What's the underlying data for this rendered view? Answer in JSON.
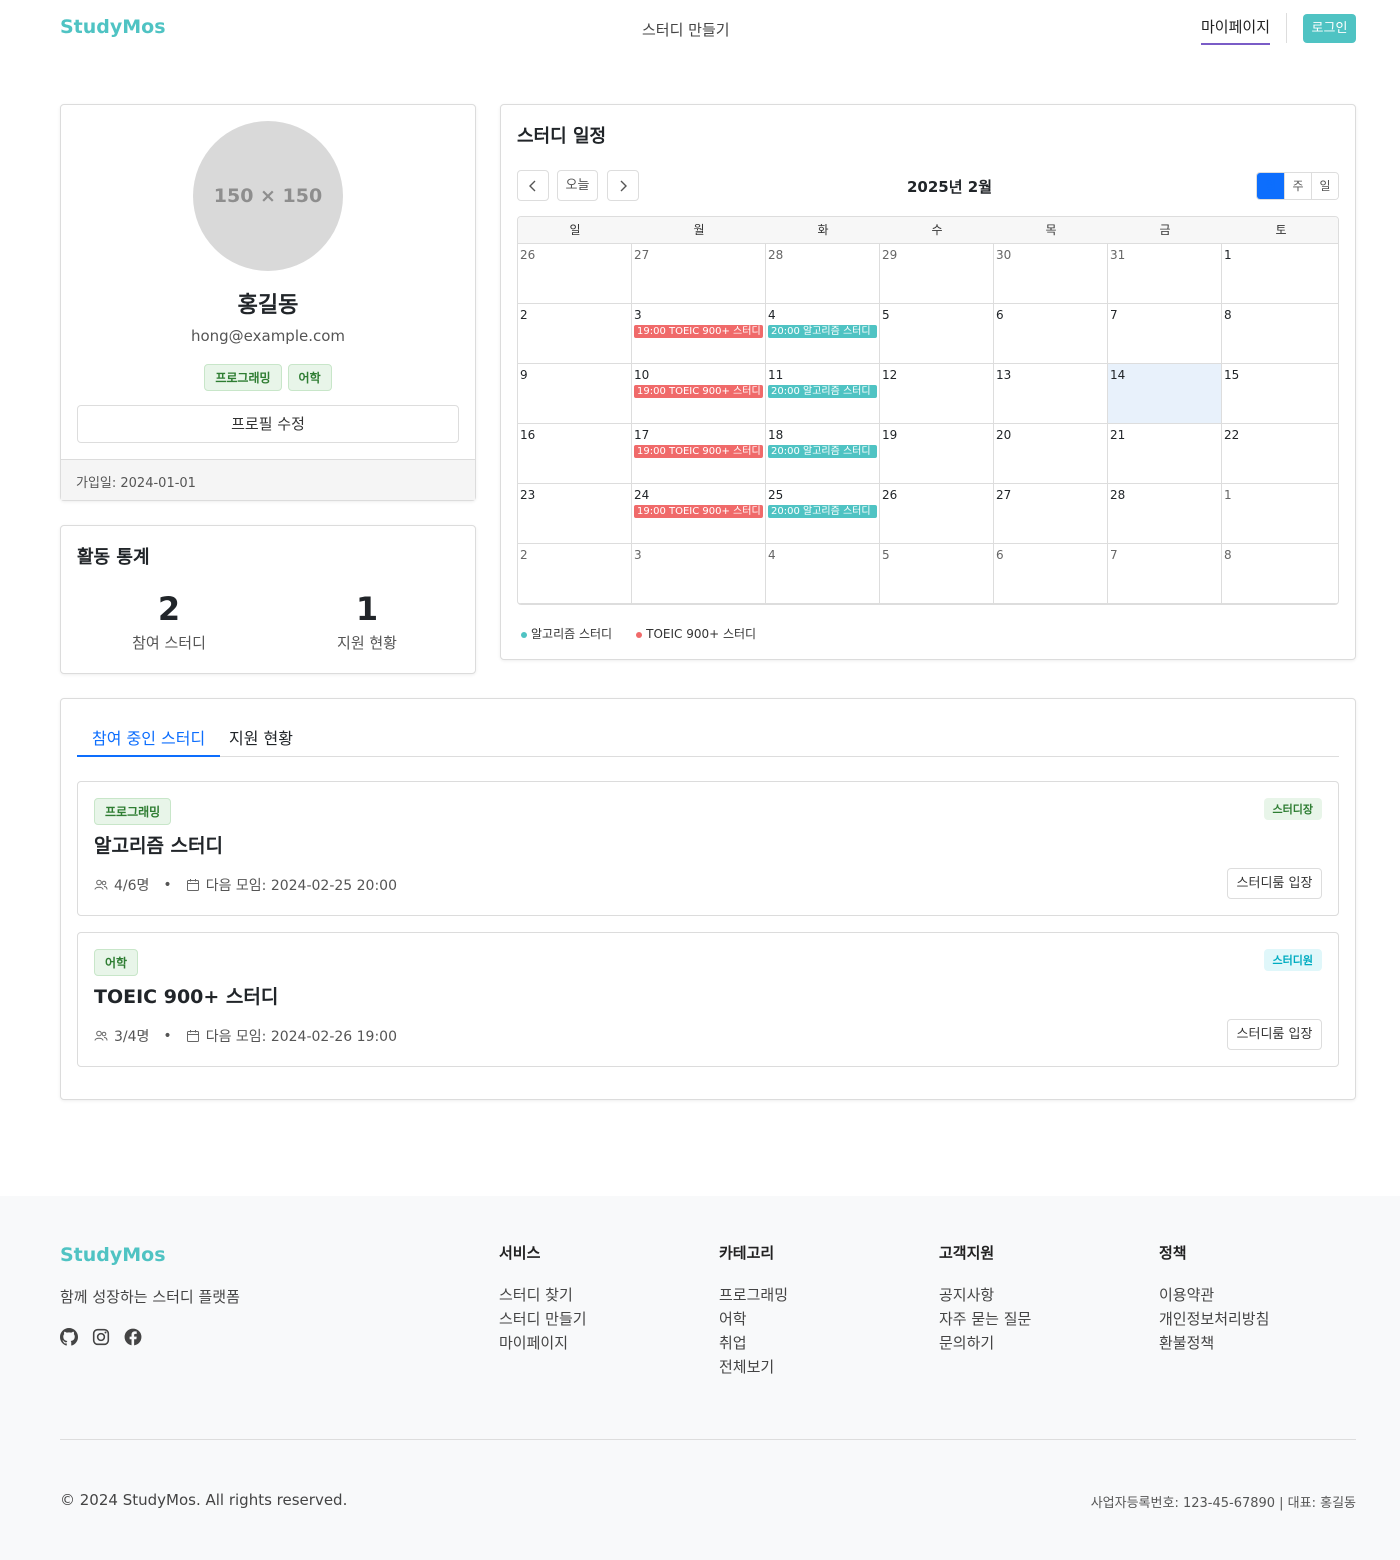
{
  "header": {
    "brand": "StudyMos",
    "nav_create": "스터디 만들기",
    "nav_mypage": "마이페이지",
    "login": "로그인"
  },
  "profile": {
    "avatar_placeholder": "150 × 150",
    "name": "홍길동",
    "email": "hong@example.com",
    "tags": [
      "프로그래밍",
      "어학"
    ],
    "edit_button": "프로필 수정",
    "joined": "가입일: 2024-01-01"
  },
  "stats": {
    "title": "활동 통계",
    "items": [
      {
        "value": "2",
        "label": "참여 스터디"
      },
      {
        "value": "1",
        "label": "지원 현황"
      }
    ]
  },
  "calendar": {
    "title": "스터디 일정",
    "today_button": "오늘",
    "month_label": "2025년 2월",
    "views": [
      "월",
      "주",
      "일"
    ],
    "active_view": "월",
    "weekdays": [
      "일",
      "월",
      "화",
      "수",
      "목",
      "금",
      "토"
    ],
    "today": 14,
    "colors": {
      "algorithm": "#4fc3c3",
      "toeic": "#f06a6a"
    },
    "weeks": [
      [
        {
          "d": "26",
          "o": true
        },
        {
          "d": "27",
          "o": true
        },
        {
          "d": "28",
          "o": true
        },
        {
          "d": "29",
          "o": true
        },
        {
          "d": "30",
          "o": true
        },
        {
          "d": "31",
          "o": true
        },
        {
          "d": "1"
        }
      ],
      [
        {
          "d": "2"
        },
        {
          "d": "3",
          "ev": "19:00 TOEIC 900+ 스터디",
          "c": "toeic"
        },
        {
          "d": "4",
          "ev": "20:00 알고리즘 스터디",
          "c": "algorithm"
        },
        {
          "d": "5"
        },
        {
          "d": "6"
        },
        {
          "d": "7"
        },
        {
          "d": "8"
        }
      ],
      [
        {
          "d": "9"
        },
        {
          "d": "10",
          "ev": "19:00 TOEIC 900+ 스터디",
          "c": "toeic"
        },
        {
          "d": "11",
          "ev": "20:00 알고리즘 스터디",
          "c": "algorithm"
        },
        {
          "d": "12"
        },
        {
          "d": "13"
        },
        {
          "d": "14"
        },
        {
          "d": "15"
        }
      ],
      [
        {
          "d": "16"
        },
        {
          "d": "17",
          "ev": "19:00 TOEIC 900+ 스터디",
          "c": "toeic"
        },
        {
          "d": "18",
          "ev": "20:00 알고리즘 스터디",
          "c": "algorithm"
        },
        {
          "d": "19"
        },
        {
          "d": "20"
        },
        {
          "d": "21"
        },
        {
          "d": "22"
        }
      ],
      [
        {
          "d": "23"
        },
        {
          "d": "24",
          "ev": "19:00 TOEIC 900+ 스터디",
          "c": "toeic"
        },
        {
          "d": "25",
          "ev": "20:00 알고리즘 스터디",
          "c": "algorithm"
        },
        {
          "d": "26"
        },
        {
          "d": "27"
        },
        {
          "d": "28"
        },
        {
          "d": "1",
          "o": true
        }
      ],
      [
        {
          "d": "2",
          "o": true
        },
        {
          "d": "3",
          "o": true
        },
        {
          "d": "4",
          "o": true
        },
        {
          "d": "5",
          "o": true
        },
        {
          "d": "6",
          "o": true
        },
        {
          "d": "7",
          "o": true
        },
        {
          "d": "8",
          "o": true
        }
      ]
    ],
    "legend": [
      {
        "label": "알고리즘 스터디",
        "c": "algorithm"
      },
      {
        "label": "TOEIC 900+ 스터디",
        "c": "toeic"
      }
    ]
  },
  "studies": {
    "tabs": [
      "참여 중인 스터디",
      "지원 현황"
    ],
    "active_tab": 0,
    "items": [
      {
        "category": "프로그래밍",
        "role": "스터디장",
        "role_type": "leader",
        "title": "알고리즘 스터디",
        "members": "4/6명",
        "next": "다음 모임: 2024-02-25 20:00",
        "enter": "스터디룸 입장"
      },
      {
        "category": "어학",
        "role": "스터디원",
        "role_type": "member",
        "title": "TOEIC 900+ 스터디",
        "members": "3/4명",
        "next": "다음 모임: 2024-02-26 19:00",
        "enter": "스터디룸 입장"
      }
    ]
  },
  "footer": {
    "brand": "StudyMos",
    "tagline": "함께 성장하는 스터디 플랫폼",
    "social": [
      "github-icon",
      "instagram-icon",
      "facebook-icon"
    ],
    "columns": [
      {
        "title": "서비스",
        "links": [
          "스터디 찾기",
          "스터디 만들기",
          "마이페이지"
        ]
      },
      {
        "title": "카테고리",
        "links": [
          "프로그래밍",
          "어학",
          "취업",
          "전체보기"
        ]
      },
      {
        "title": "고객지원",
        "links": [
          "공지사항",
          "자주 묻는 질문",
          "문의하기"
        ]
      },
      {
        "title": "정책",
        "links": [
          "이용약관",
          "개인정보처리방침",
          "환불정책"
        ]
      }
    ],
    "copyright": "© 2024 StudyMos. All rights reserved.",
    "business": "사업자등록번호: 123-45-67890 | 대표: 홍길동"
  }
}
